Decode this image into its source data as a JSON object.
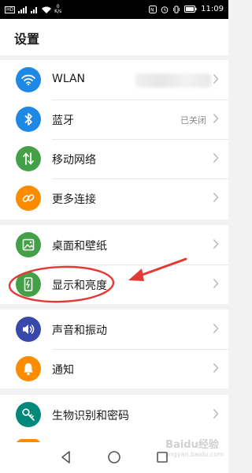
{
  "status_bar": {
    "sim_label": "HD",
    "speed_value": "0",
    "speed_unit": "K/s",
    "time": "11:09"
  },
  "header": {
    "title": "设置"
  },
  "groups": [
    {
      "items": [
        {
          "label": "WLAN",
          "value": "",
          "icon": "wifi-icon",
          "color": "#1e88e5"
        },
        {
          "label": "蓝牙",
          "value": "已关闭",
          "icon": "bluetooth-icon",
          "color": "#1e88e5"
        },
        {
          "label": "移动网络",
          "value": "",
          "icon": "mobile-network-icon",
          "color": "#43a047"
        },
        {
          "label": "更多连接",
          "value": "",
          "icon": "link-icon",
          "color": "#fb8c00"
        }
      ]
    },
    {
      "items": [
        {
          "label": "桌面和壁纸",
          "value": "",
          "icon": "wallpaper-icon",
          "color": "#43a047"
        },
        {
          "label": "显示和亮度",
          "value": "",
          "icon": "display-icon",
          "color": "#43a047"
        }
      ]
    },
    {
      "items": [
        {
          "label": "声音和振动",
          "value": "",
          "icon": "sound-icon",
          "color": "#3949ab"
        },
        {
          "label": "通知",
          "value": "",
          "icon": "notification-bell-icon",
          "color": "#fb8c00"
        }
      ]
    },
    {
      "items": [
        {
          "label": "生物识别和密码",
          "value": "",
          "icon": "key-icon",
          "color": "#00897b"
        }
      ]
    }
  ],
  "colors": {
    "annotation": "#e53935",
    "chevron": "#b5b5b5",
    "accent_blue": "#1e88e5"
  },
  "watermark": {
    "text": "Baidu经验",
    "subtext": "jingyan.baidu.com"
  }
}
